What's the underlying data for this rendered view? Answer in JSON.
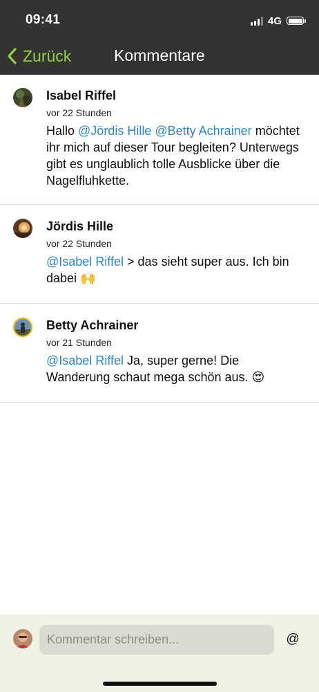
{
  "status_bar": {
    "time": "09:41",
    "network": "4G"
  },
  "nav": {
    "back_label": "Zurück",
    "title": "Kommentare"
  },
  "comments": [
    {
      "author": "Isabel Riffel",
      "time": "vor 22 Stunden",
      "text": {
        "prefix": "Hallo ",
        "mention_1": "@Jördis Hille",
        "mention_2": "@Betty Achrainer",
        "body": "möchtet ihr mich auf dieser Tour begleiten? Unterwegs gibt es unglaublich tolle Ausblicke über die Nagelfluhkette."
      }
    },
    {
      "author": "Jördis Hille",
      "time": "vor 22 Stunden",
      "text": {
        "mention": "@Isabel Riffel",
        "body": " > das sieht super aus. Ich bin dabei ",
        "emoji": "🙌"
      }
    },
    {
      "author": "Betty Achrainer",
      "time": "vor 21 Stunden",
      "text": {
        "mention": "@Isabel Riffel",
        "body": " Ja, super gerne! Die Wanderung schaut mega schön aus. ",
        "emoji": "😍"
      }
    }
  ],
  "composer": {
    "placeholder": "Kommentar schreiben...",
    "at_symbol": "@"
  },
  "colors": {
    "header_bg": "#333431",
    "accent_green": "#8fd24a",
    "mention_blue": "#2a86d1",
    "composer_bg": "#f2f1e6"
  },
  "icons": {
    "back": "chevron-left-icon",
    "signal": "signal-bars-icon",
    "battery": "battery-icon"
  }
}
